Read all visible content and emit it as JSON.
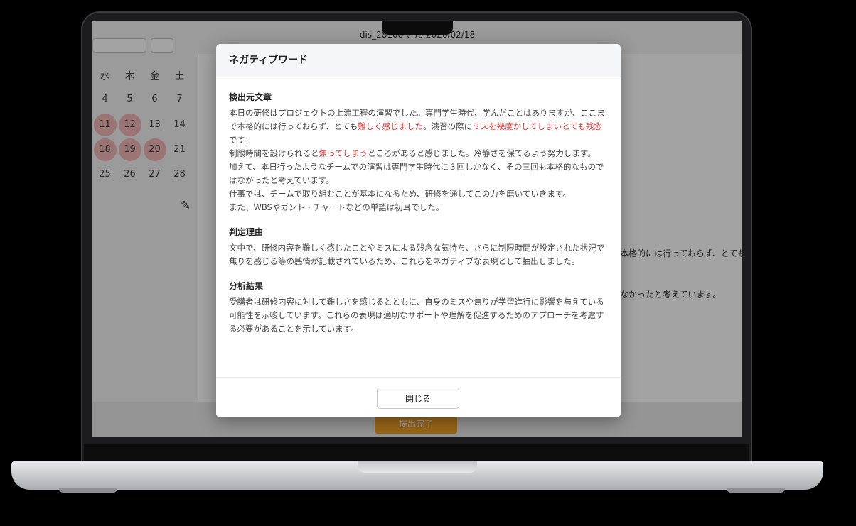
{
  "screen": {
    "title": "dis_28108 さん 2026/02/18",
    "calendar": {
      "weekdays": [
        "水",
        "木",
        "金",
        "土"
      ],
      "rows": [
        [
          "4",
          "5",
          "6",
          "7"
        ],
        [
          "11",
          "12",
          "13",
          "14"
        ],
        [
          "18",
          "19",
          "20",
          "21"
        ],
        [
          "25",
          "26",
          "27",
          "28"
        ]
      ]
    },
    "background_text": {
      "line1": "本格的には行っておらず、とても",
      "line2": "なかったと考えています。"
    },
    "submit_label": "提出完了"
  },
  "modal": {
    "title": "ネガティブワード",
    "sections": {
      "source": {
        "heading": "検出元文章",
        "p1_a": "本日の研修はプロジェクトの上流工程の演習でした。専門学生時代、学んだことはありますが、ここまで本格的には行っておらず、とても",
        "p1_neg1": "難しく感じました",
        "p1_b": "。演習の際に",
        "p1_neg2": "ミスを幾度かしてしまいとても残念",
        "p1_c": "です。",
        "p2_a": "制限時間を設けられると",
        "p2_neg": "焦ってしまう",
        "p2_b": "ところがあると感じました。冷静さを保てるよう努力します。",
        "p3": "加えて、本日行ったようなチームでの演習は専門学生時代に３回しかなく、その三回も本格的なものではなかったと考えています。",
        "p4": "仕事では、チームで取り組むことが基本になるため、研修を通してこの力を磨いていきます。",
        "p5": "また、WBSやガント・チャートなどの単語は初耳でした。"
      },
      "reason": {
        "heading": "判定理由",
        "text": "文中で、研修内容を難しく感じたことやミスによる残念な気持ち、さらに制限時間が設定された状況で焦りを感じる等の感情が記載されているため、これらをネガティブな表現として抽出しました。"
      },
      "result": {
        "heading": "分析結果",
        "text": "受講者は研修内容に対して難しさを感じるとともに、自身のミスや焦りが学習進行に影響を与えている可能性を示唆しています。これらの表現は適切なサポートや理解を促進するためのアプローチを考慮する必要があることを示しています。"
      }
    },
    "close_label": "閉じる"
  },
  "colors": {
    "negative_highlight": "#e53935",
    "submit_button": "#f0a023",
    "calendar_highlight": "#f2b6b6"
  }
}
